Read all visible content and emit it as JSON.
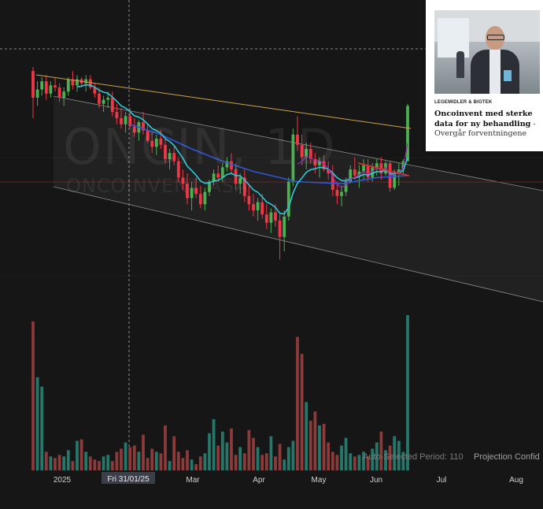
{
  "watermark": {
    "symbol": "ONCIN, 1D",
    "company": "ONCOINVENT ASA"
  },
  "news_card": {
    "category": "LEGEMIDLER & BIOTEK",
    "headline_bold": "Oncoinvent med sterke data for ny behandling",
    "headline_rest": " - Overgår forventningene",
    "photo": "man-in-suit-photo"
  },
  "footer": {
    "auto_period_text": "Auto-Selected Period: 110",
    "projection_text": "Projection Confid"
  },
  "time_axis": {
    "labels": [
      "2025",
      "Mar",
      "Apr",
      "May",
      "Jun",
      "Jul",
      "Aug"
    ],
    "crosshair_label": "Fri 31/01/25"
  },
  "colors": {
    "background": "#161616",
    "up_candle": "#4caf50",
    "down_candle": "#f23645",
    "up_volume": "#26776a",
    "down_volume": "#8c3a3a",
    "ema_fast": "#9c27b0",
    "ema_mid": "#2ec7d6",
    "ema_slow": "#2f56d8",
    "trendline": "#c9a44c",
    "channel": "#8a8a8a",
    "red_line": "#d32f2f"
  },
  "chart_data": {
    "type": "candlestick",
    "price_scale": "unlabeled",
    "candles_ohlc": [
      [
        98,
        100,
        75,
        85
      ],
      [
        85,
        93,
        81,
        89
      ],
      [
        89,
        95,
        86,
        93
      ],
      [
        93,
        96,
        84,
        87
      ],
      [
        87,
        93,
        85,
        91
      ],
      [
        91,
        95,
        88,
        90
      ],
      [
        90,
        92,
        83,
        85
      ],
      [
        85,
        90,
        81,
        88
      ],
      [
        88,
        95,
        86,
        94
      ],
      [
        94,
        98,
        89,
        91
      ],
      [
        91,
        96,
        88,
        94
      ],
      [
        94,
        95,
        90,
        92
      ],
      [
        92,
        96,
        88,
        94
      ],
      [
        94,
        96,
        89,
        90
      ],
      [
        90,
        92,
        85,
        87
      ],
      [
        87,
        90,
        80,
        82
      ],
      [
        82,
        86,
        78,
        84
      ],
      [
        84,
        88,
        80,
        85
      ],
      [
        85,
        88,
        76,
        78
      ],
      [
        78,
        82,
        72,
        75
      ],
      [
        75,
        80,
        70,
        72
      ],
      [
        72,
        78,
        68,
        76
      ],
      [
        76,
        80,
        70,
        71
      ],
      [
        71,
        75,
        66,
        68
      ],
      [
        68,
        74,
        64,
        73
      ],
      [
        73,
        78,
        67,
        69
      ],
      [
        69,
        72,
        63,
        64
      ],
      [
        64,
        68,
        58,
        61
      ],
      [
        61,
        67,
        57,
        65
      ],
      [
        65,
        69,
        60,
        62
      ],
      [
        62,
        65,
        53,
        55
      ],
      [
        55,
        60,
        50,
        58
      ],
      [
        58,
        62,
        52,
        54
      ],
      [
        54,
        56,
        44,
        46
      ],
      [
        46,
        50,
        40,
        43
      ],
      [
        43,
        48,
        33,
        36
      ],
      [
        36,
        44,
        30,
        41
      ],
      [
        41,
        46,
        36,
        38
      ],
      [
        38,
        42,
        31,
        33
      ],
      [
        33,
        41,
        30,
        39
      ],
      [
        39,
        45,
        37,
        44
      ],
      [
        44,
        50,
        42,
        48
      ],
      [
        48,
        52,
        44,
        46
      ],
      [
        46,
        53,
        44,
        51
      ],
      [
        51,
        56,
        49,
        54
      ],
      [
        54,
        58,
        48,
        50
      ],
      [
        50,
        53,
        40,
        43
      ],
      [
        43,
        48,
        38,
        46
      ],
      [
        46,
        50,
        34,
        37
      ],
      [
        37,
        42,
        30,
        33
      ],
      [
        33,
        38,
        27,
        30
      ],
      [
        30,
        36,
        25,
        34
      ],
      [
        34,
        38,
        26,
        28
      ],
      [
        28,
        33,
        21,
        24
      ],
      [
        24,
        31,
        19,
        29
      ],
      [
        29,
        33,
        22,
        25
      ],
      [
        25,
        28,
        6,
        17
      ],
      [
        17,
        30,
        10,
        27
      ],
      [
        27,
        46,
        25,
        44
      ],
      [
        44,
        70,
        42,
        67
      ],
      [
        67,
        76,
        59,
        62
      ],
      [
        62,
        67,
        52,
        56
      ],
      [
        56,
        63,
        50,
        60
      ],
      [
        60,
        63,
        53,
        55
      ],
      [
        55,
        58,
        48,
        52
      ],
      [
        52,
        56,
        46,
        54
      ],
      [
        54,
        57,
        49,
        50
      ],
      [
        50,
        54,
        45,
        48
      ],
      [
        48,
        52,
        37,
        40
      ],
      [
        40,
        44,
        33,
        37
      ],
      [
        37,
        42,
        32,
        39
      ],
      [
        39,
        46,
        37,
        44
      ],
      [
        44,
        52,
        43,
        50
      ],
      [
        50,
        56,
        45,
        47
      ],
      [
        47,
        52,
        41,
        49
      ],
      [
        49,
        55,
        45,
        52
      ],
      [
        52,
        55,
        44,
        46
      ],
      [
        46,
        53,
        44,
        51
      ],
      [
        51,
        55,
        47,
        53
      ],
      [
        53,
        56,
        45,
        48
      ],
      [
        48,
        54,
        47,
        53
      ],
      [
        53,
        54,
        39,
        41
      ],
      [
        41,
        50,
        40,
        48
      ],
      [
        48,
        53,
        42,
        50
      ],
      [
        50,
        55,
        48,
        54
      ],
      [
        54,
        82,
        54,
        81
      ]
    ],
    "volumes": [
      96,
      60,
      54,
      12,
      9,
      8,
      10,
      9,
      13,
      6,
      19,
      20,
      12,
      9,
      7,
      6,
      9,
      10,
      6,
      12,
      14,
      18,
      15,
      16,
      12,
      23,
      8,
      14,
      12,
      11,
      29,
      6,
      22,
      12,
      8,
      13,
      7,
      4,
      9,
      11,
      24,
      33,
      16,
      25,
      18,
      27,
      10,
      15,
      11,
      26,
      21,
      15,
      10,
      11,
      22,
      9,
      17,
      7,
      15,
      19,
      86,
      75,
      44,
      32,
      38,
      29,
      30,
      18,
      12,
      10,
      16,
      21,
      11,
      9,
      10,
      12,
      9,
      14,
      18,
      25,
      13,
      16,
      22,
      19,
      12,
      100
    ],
    "ema_slow": [
      [
        22,
        72
      ],
      [
        29,
        67
      ],
      [
        36,
        60
      ],
      [
        43,
        54
      ],
      [
        50,
        49
      ],
      [
        60,
        44
      ],
      [
        70,
        43
      ],
      [
        78,
        46
      ],
      [
        85,
        47
      ]
    ],
    "x_labels": [
      "2025",
      "Mar",
      "Apr",
      "May",
      "Jun",
      "Jul",
      "Aug"
    ],
    "crosshair_date": "Fri 31/01/25"
  }
}
